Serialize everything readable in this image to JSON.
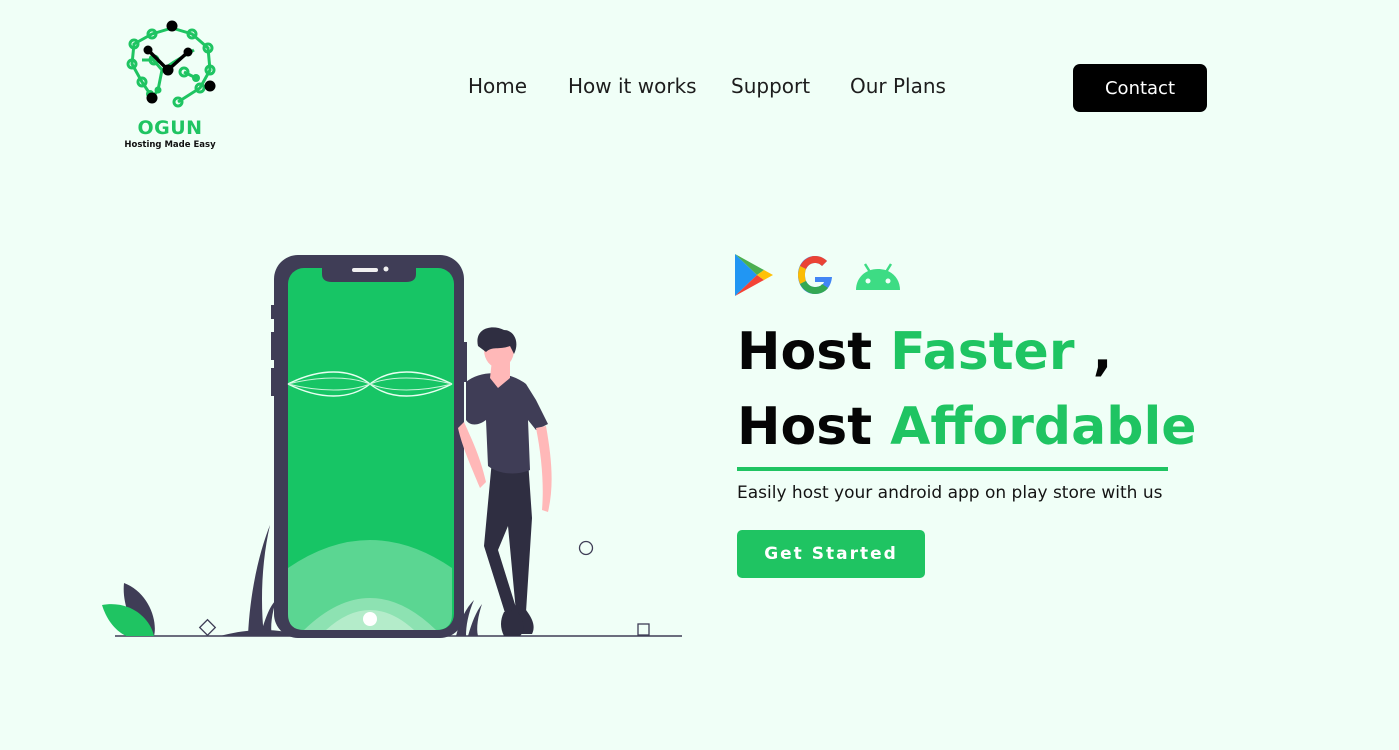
{
  "brand": {
    "name": "OGUN",
    "tagline": "Hosting Made Easy",
    "logo_icon": "circuit-clock-icon",
    "color": "#1fc462"
  },
  "nav": {
    "items": [
      {
        "label": "Home"
      },
      {
        "label": "How it works"
      },
      {
        "label": "Support"
      },
      {
        "label": "Our Plans"
      }
    ],
    "contact_label": "Contact"
  },
  "hero": {
    "platform_icons": [
      "play-store-icon",
      "google-icon",
      "android-icon"
    ],
    "line1_word": "Host",
    "line1_accent": "Faster",
    "line1_suffix": " ,",
    "line2_word": "Host",
    "line2_accent": "Affordable",
    "subtitle": "Easily host your android app on play store with us",
    "cta_label": "Get Started"
  },
  "illustration": {
    "subject": "person-leaning-on-phone",
    "screen_color": "#17c565",
    "frame_color": "#3f3d56"
  }
}
